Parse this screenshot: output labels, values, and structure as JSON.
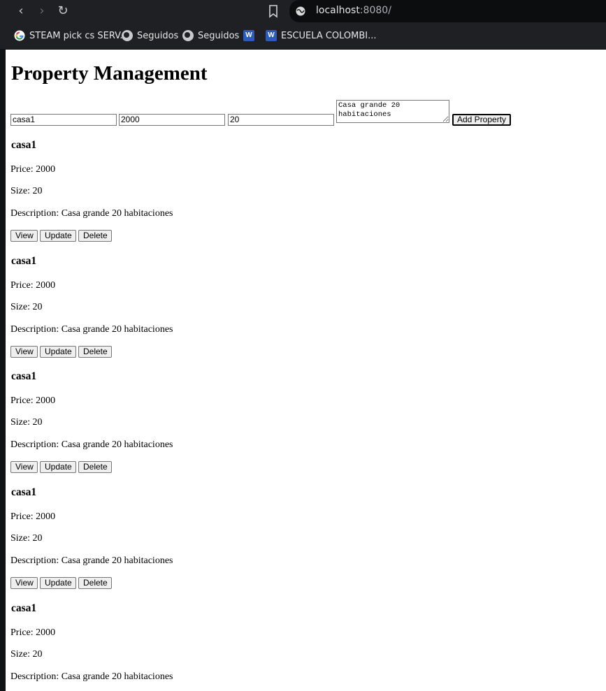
{
  "browser": {
    "url_host": "localhost",
    "url_port": ":8080/",
    "bookmarks": [
      {
        "label": "STEAM pick cs SERV...",
        "icon": "google-icon"
      },
      {
        "label": "Seguidos",
        "icon": "globe-icon"
      },
      {
        "label": "Seguidos",
        "icon": "globe-icon"
      },
      {
        "label": "",
        "icon": "word-icon"
      },
      {
        "label": "ESCUELA COLOMBI...",
        "icon": "word-icon"
      }
    ]
  },
  "page": {
    "title": "Property Management",
    "form": {
      "name_value": "casa1",
      "price_value": "2000",
      "size_value": "20",
      "description_value": "Casa grande 20 habitaciones",
      "add_button": "Add Property"
    },
    "properties": [
      {
        "name": "casa1",
        "price": "Price: 2000",
        "size": "Size: 20",
        "description": "Description: Casa grande 20 habitaciones"
      },
      {
        "name": "casa1",
        "price": "Price: 2000",
        "size": "Size: 20",
        "description": "Description: Casa grande 20 habitaciones"
      },
      {
        "name": "casa1",
        "price": "Price: 2000",
        "size": "Size: 20",
        "description": "Description: Casa grande 20 habitaciones"
      },
      {
        "name": "casa1",
        "price": "Price: 2000",
        "size": "Size: 20",
        "description": "Description: Casa grande 20 habitaciones"
      },
      {
        "name": "casa1",
        "price": "Price: 2000",
        "size": "Size: 20",
        "description": "Description: Casa grande 20 habitaciones"
      }
    ],
    "actions": {
      "view": "View",
      "update": "Update",
      "delete": "Delete"
    }
  }
}
